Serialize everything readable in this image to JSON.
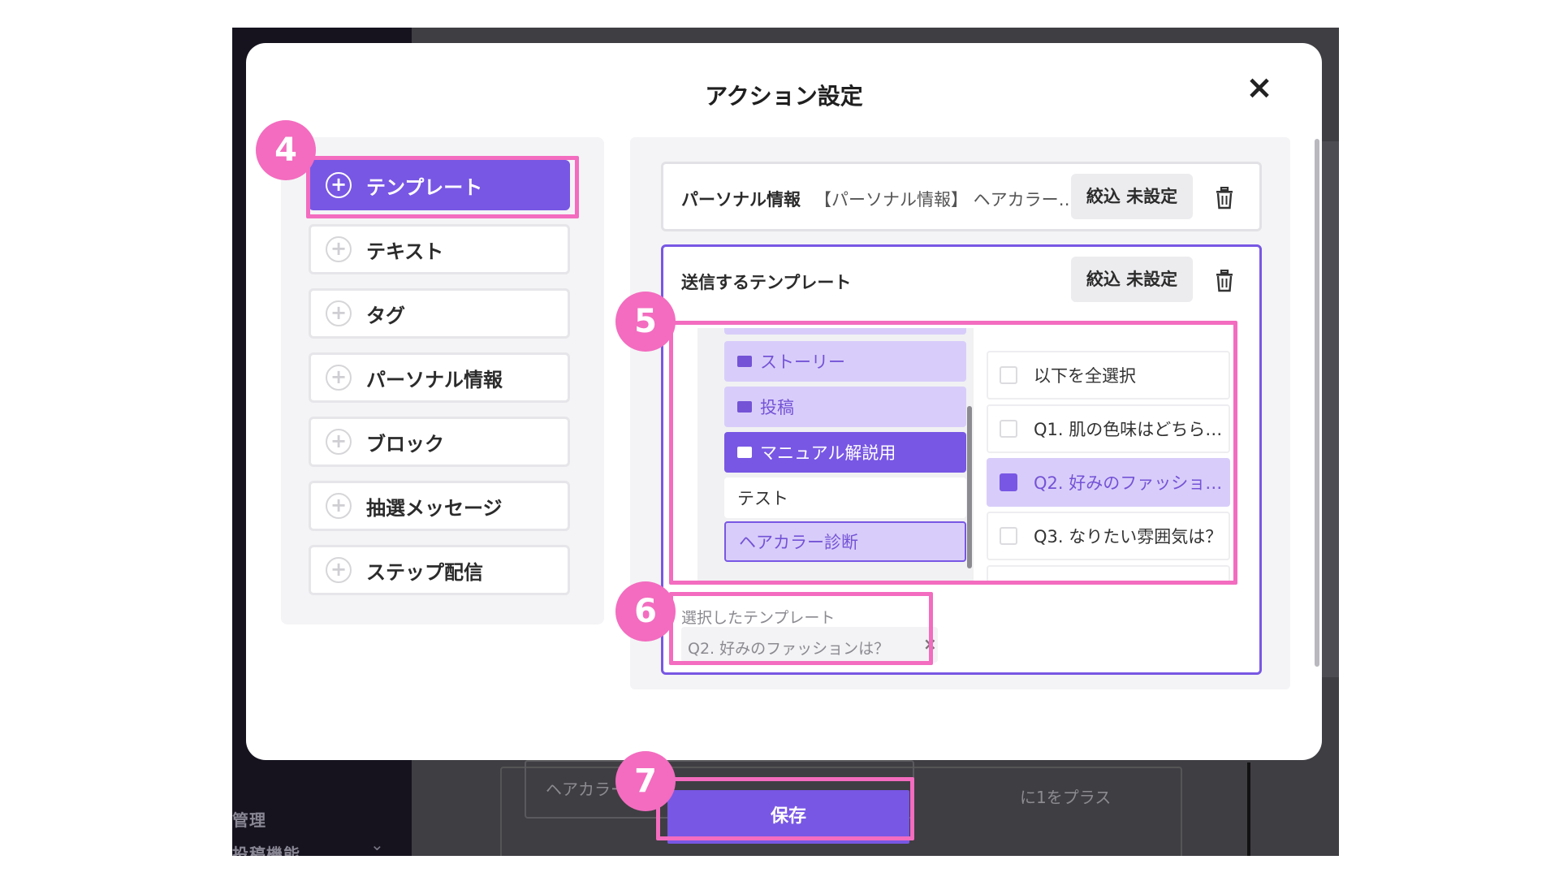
{
  "background": {
    "sidebar_menu_1": "管理",
    "sidebar_menu_2": "投稿機能",
    "field_text": "ヘアカラー",
    "field_text_right": "に1をプラス"
  },
  "modal": {
    "title": "アクション設定",
    "close_icon": "×"
  },
  "actions": [
    {
      "label": "テンプレート",
      "active": true
    },
    {
      "label": "テキスト",
      "active": false
    },
    {
      "label": "タグ",
      "active": false
    },
    {
      "label": "パーソナル情報",
      "active": false
    },
    {
      "label": "ブロック",
      "active": false
    },
    {
      "label": "抽選メッセージ",
      "active": false
    },
    {
      "label": "ステップ配信",
      "active": false
    }
  ],
  "personal_card": {
    "label": "パーソナル情報",
    "value": "【パーソナル情報】 ヘアカラー…",
    "filter_label": "絞込 未設定"
  },
  "template_card": {
    "title": "送信するテンプレート",
    "filter_label": "絞込 未設定",
    "folders": [
      {
        "label": "ストーリー",
        "style": "light",
        "icon": "folder-icon"
      },
      {
        "label": "投稿",
        "style": "light",
        "icon": "folder-icon"
      },
      {
        "label": "マニュアル解説用",
        "style": "dark",
        "icon": "folder-open-icon"
      },
      {
        "label": "テスト",
        "style": "plain"
      },
      {
        "label": "ヘアカラー診断",
        "style": "outline"
      }
    ],
    "templates": [
      {
        "label": "以下を全選択",
        "selected": false
      },
      {
        "label": "Q1. 肌の色味はどちら…",
        "selected": false
      },
      {
        "label": "Q2. 好みのファッショ…",
        "selected": true
      },
      {
        "label": "Q3. なりたい雰囲気は？",
        "selected": false
      }
    ],
    "selected_label": "選択したテンプレート",
    "selected_chip": "Q2. 好みのファッションは？",
    "chip_remove": "×"
  },
  "save_label": "保存",
  "badges": [
    "4",
    "5",
    "6",
    "7"
  ],
  "colors": {
    "accent": "#7857e4",
    "highlight": "#f36cbf",
    "light_accent": "#d8cdfa"
  }
}
